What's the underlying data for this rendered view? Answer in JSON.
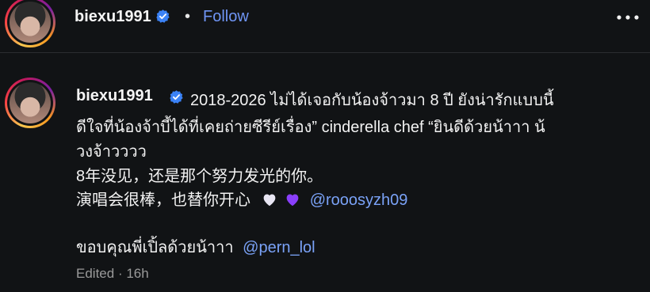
{
  "header": {
    "username": "biexu1991",
    "separator": "•",
    "follow_label": "Follow",
    "more_icon": "more-options-icon"
  },
  "post": {
    "username": "biexu1991",
    "lines": {
      "l1_text": "2018-2026 ไม่ได้เจอกับน้องจ้าวมา 8 ปี ยังน่ารักแบบนี้",
      "l2_text": "ดีใจที่น้องจ้าบี้ได้ที่เคยถ่ายซีรีย์เรื่อง” cinderella chef “ยินดีด้วยน้าาา น้",
      "l3_text": "วงจ้าวววว",
      "l4_text": "8年没见，还是那个努力发光的你。",
      "l5_text": "演唱会很棒，也替你开心",
      "l5_mention": "@rooosyzh09",
      "l6_text": "ขอบคุณพี่เปิ้ลด้วยน้าาา",
      "l6_mention": "@pern_lol"
    },
    "meta": {
      "edited": "Edited",
      "separator": "·",
      "time": "16h"
    }
  },
  "colors": {
    "background": "#111315",
    "link": "#6f95f5",
    "verified": "#3b82f6",
    "white_heart": "#e8e6f3",
    "purple_heart": "#8a3ffc"
  }
}
